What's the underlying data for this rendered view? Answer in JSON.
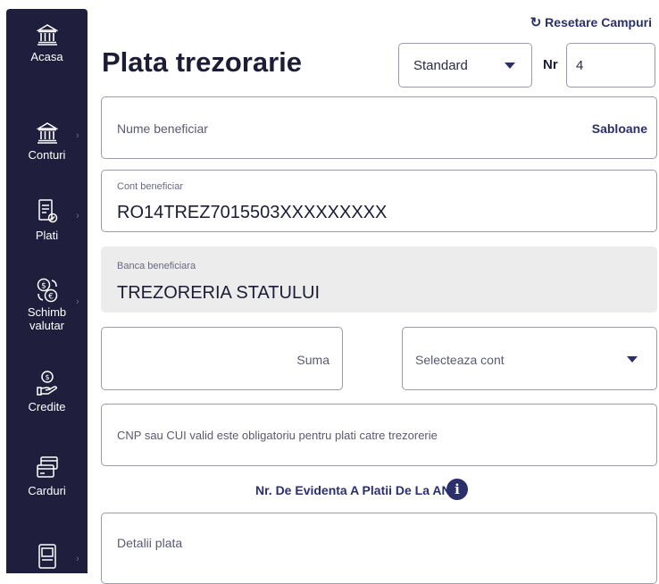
{
  "sidebar": {
    "items": [
      {
        "label": "Acasa",
        "icon": "bank-icon"
      },
      {
        "label": "Conturi",
        "icon": "bank-icon"
      },
      {
        "label": "Plati",
        "icon": "payment-document-icon"
      },
      {
        "label": "Schimb valutar",
        "icon": "currency-exchange-icon"
      },
      {
        "label": "Credite",
        "icon": "credit-hand-coin-icon"
      },
      {
        "label": "Carduri",
        "icon": "cards-icon"
      },
      {
        "label": "",
        "icon": "device-icon"
      }
    ]
  },
  "header": {
    "reset_label": "Resetare Campuri",
    "title": "Plata trezorarie",
    "type_select": "Standard",
    "nr_label": "Nr",
    "nr_value": "4"
  },
  "form": {
    "beneficiary_name_placeholder": "Nume beneficiar",
    "templates_label": "Sabloane",
    "account_label": "Cont beneficiar",
    "account_value": "RO14TREZ7015503XXXXXXXXX",
    "bank_label": "Banca beneficiara",
    "bank_value": "TREZORERIA STATULUI",
    "amount_placeholder": "Suma",
    "source_account_placeholder": "Selecteaza cont",
    "cnp_placeholder": "CNP sau CUI valid este obligatoriu pentru plati catre trezorerie",
    "anaf_label": "Nr. De Evidenta A Platii De La ANAF",
    "details_placeholder": "Detalii plata"
  },
  "colors": {
    "sidebar": "#1f1f3d",
    "accent": "#2b2f6b",
    "disabled_bg": "#ececec"
  }
}
